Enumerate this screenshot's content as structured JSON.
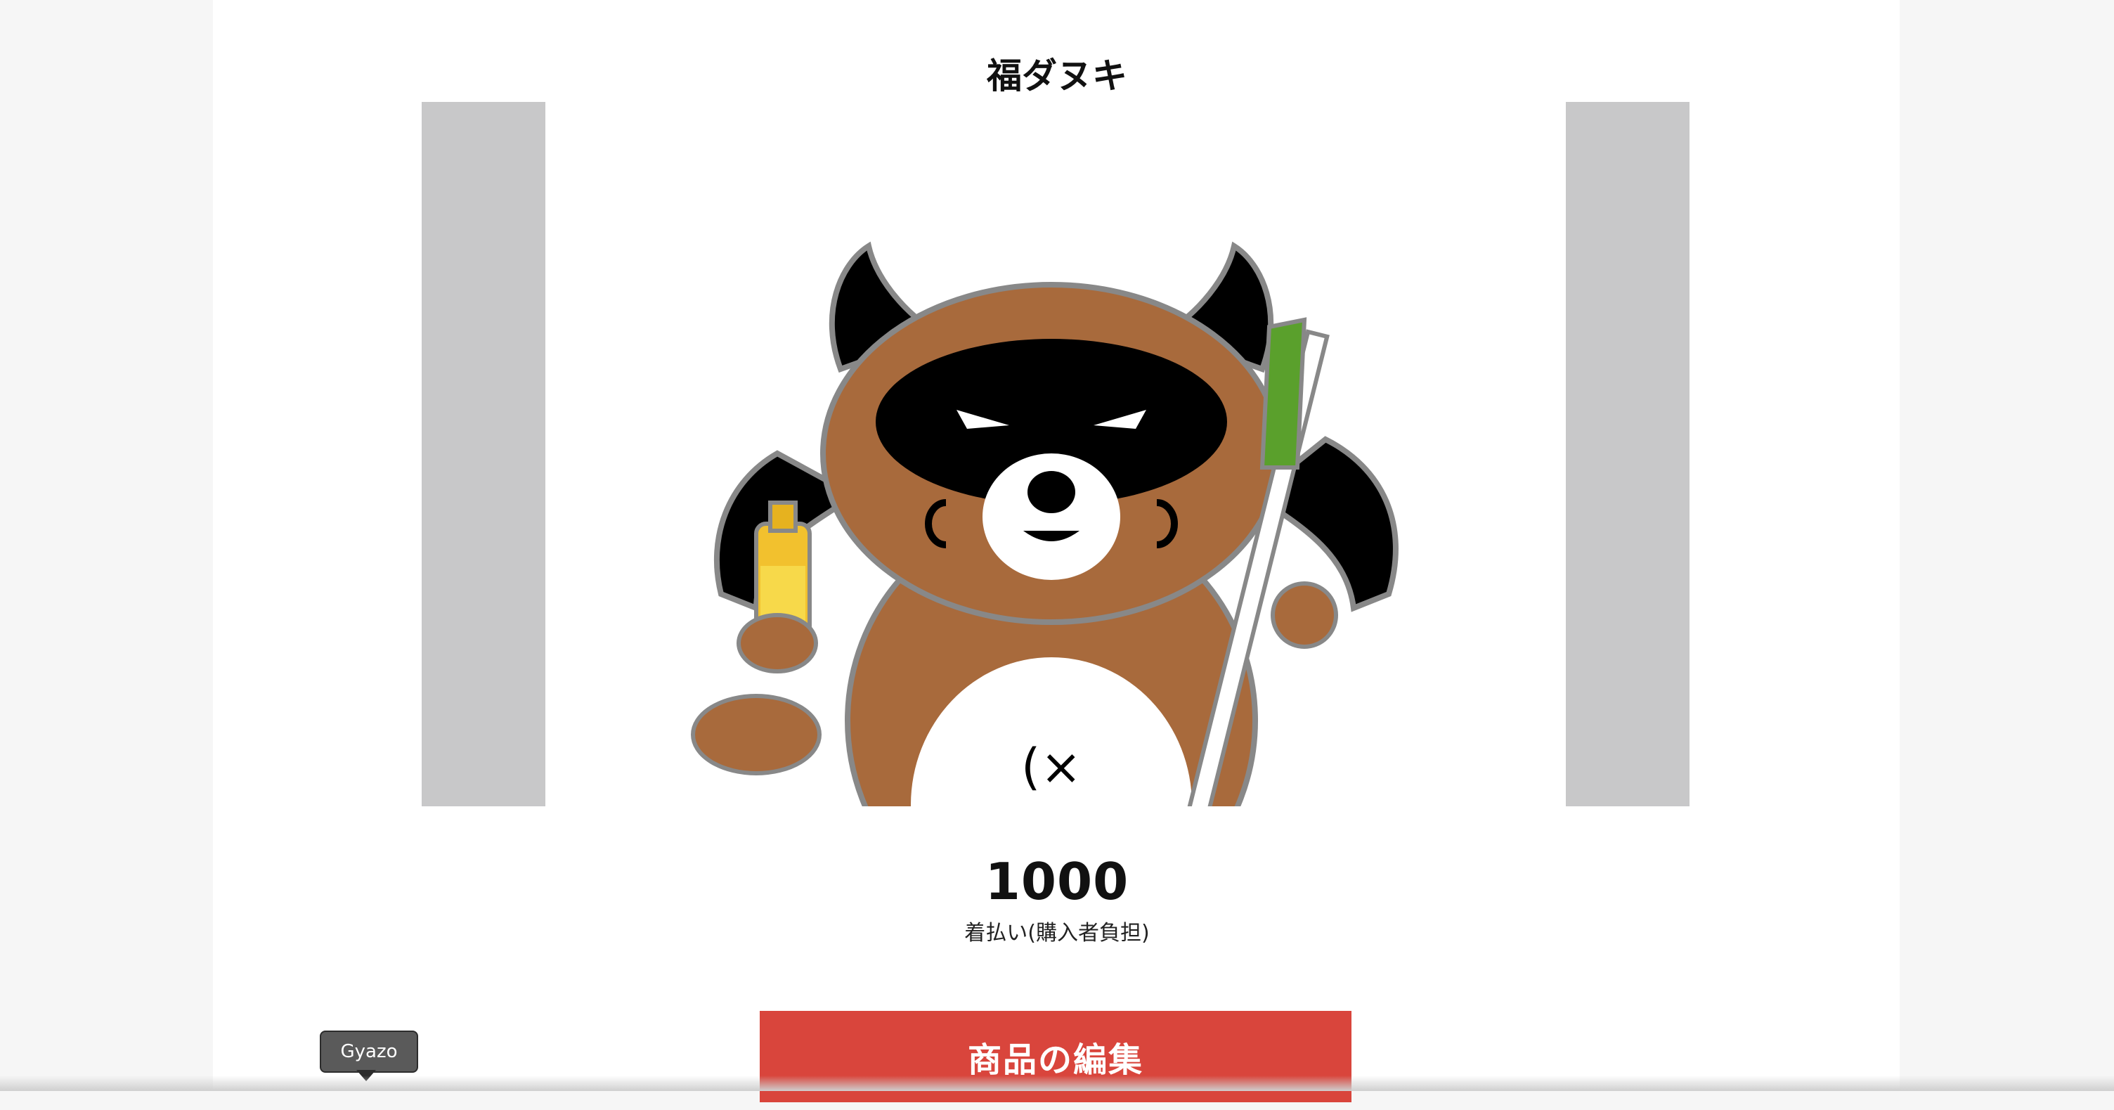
{
  "product": {
    "name": "福ダヌキ",
    "price": "1000",
    "shipping": "着払い(購入者負担)"
  },
  "actions": {
    "edit_label": "商品の編集"
  },
  "tooltip": {
    "label": "Gyazo"
  },
  "colors": {
    "accent": "#d9453c",
    "image_bg": "#c8c8c9",
    "page_bg": "#f6f6f6"
  }
}
